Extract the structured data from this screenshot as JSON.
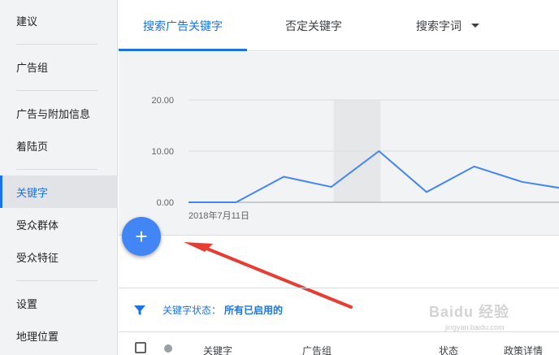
{
  "sidebar": {
    "items": [
      {
        "label": "建议"
      },
      {
        "label": "广告组"
      },
      {
        "label": "广告与附加信息"
      },
      {
        "label": "着陆页"
      },
      {
        "label": "关键字",
        "active": true
      },
      {
        "label": "受众群体"
      },
      {
        "label": "受众特征"
      },
      {
        "label": "设置"
      },
      {
        "label": "地理位置"
      }
    ]
  },
  "tabs": [
    {
      "label": "搜索广告关键字",
      "active": true
    },
    {
      "label": "否定关键字"
    },
    {
      "label": "搜索字词"
    }
  ],
  "chart_data": {
    "type": "line",
    "y_ticks": [
      "20.00",
      "10.00",
      "0.00"
    ],
    "ylim": [
      0,
      20
    ],
    "x_label_first": "2018年7月11日",
    "series": [
      {
        "values": [
          0,
          0,
          5,
          3,
          10,
          2,
          7,
          4,
          2.5
        ],
        "color": "#4285f4"
      }
    ],
    "highlight_index": [
      3,
      4
    ]
  },
  "fab": {
    "symbol": "+"
  },
  "filter": {
    "label": "关键字状态：",
    "value": "所有已启用的"
  },
  "table": {
    "columns": [
      "关键字",
      "广告组",
      "状态",
      "政策详情"
    ]
  },
  "watermark": {
    "text": "Baidu 经验",
    "sub": "jingyan.baidu.com"
  },
  "colors": {
    "accent": "#1a73e8",
    "fab": "#4285f4",
    "arrow": "#ea3b33"
  }
}
